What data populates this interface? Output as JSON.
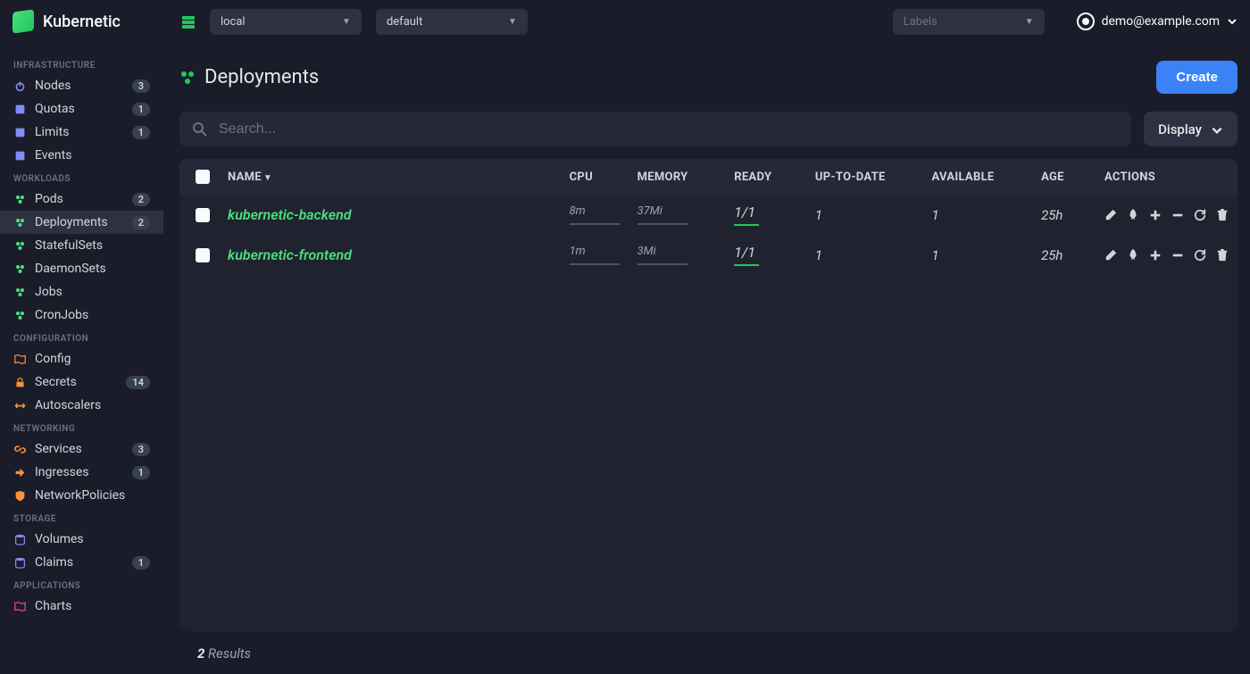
{
  "header": {
    "brand": "Kubernetic",
    "context_dropdown": "local",
    "namespace_dropdown": "default",
    "labels_placeholder": "Labels",
    "user_email": "demo@example.com"
  },
  "sidebar": {
    "sections": [
      {
        "header": "INFRASTRUCTURE",
        "items": [
          {
            "icon": "power",
            "color": "#818cf8",
            "label": "Nodes",
            "badge": "3"
          },
          {
            "icon": "square",
            "color": "#818cf8",
            "label": "Quotas",
            "badge": "1"
          },
          {
            "icon": "square",
            "color": "#818cf8",
            "label": "Limits",
            "badge": "1"
          },
          {
            "icon": "square",
            "color": "#818cf8",
            "label": "Events",
            "badge": ""
          }
        ]
      },
      {
        "header": "WORKLOADS",
        "items": [
          {
            "icon": "cubes",
            "color": "#4ade80",
            "label": "Pods",
            "badge": "2"
          },
          {
            "icon": "cubes",
            "color": "#4ade80",
            "label": "Deployments",
            "badge": "2",
            "active": true
          },
          {
            "icon": "cubes",
            "color": "#4ade80",
            "label": "StatefulSets",
            "badge": ""
          },
          {
            "icon": "cubes",
            "color": "#4ade80",
            "label": "DaemonSets",
            "badge": ""
          },
          {
            "icon": "cubes",
            "color": "#4ade80",
            "label": "Jobs",
            "badge": ""
          },
          {
            "icon": "cubes",
            "color": "#4ade80",
            "label": "CronJobs",
            "badge": ""
          }
        ]
      },
      {
        "header": "CONFIGURATION",
        "items": [
          {
            "icon": "map",
            "color": "#fb923c",
            "label": "Config",
            "badge": ""
          },
          {
            "icon": "lock",
            "color": "#fb923c",
            "label": "Secrets",
            "badge": "14"
          },
          {
            "icon": "arrows",
            "color": "#fb923c",
            "label": "Autoscalers",
            "badge": ""
          }
        ]
      },
      {
        "header": "NETWORKING",
        "items": [
          {
            "icon": "link",
            "color": "#fb923c",
            "label": "Services",
            "badge": "3"
          },
          {
            "icon": "signin",
            "color": "#fb923c",
            "label": "Ingresses",
            "badge": "1"
          },
          {
            "icon": "shield",
            "color": "#fb923c",
            "label": "NetworkPolicies",
            "badge": ""
          }
        ]
      },
      {
        "header": "STORAGE",
        "items": [
          {
            "icon": "database",
            "color": "#818cf8",
            "label": "Volumes",
            "badge": ""
          },
          {
            "icon": "database",
            "color": "#818cf8",
            "label": "Claims",
            "badge": "1"
          }
        ]
      },
      {
        "header": "APPLICATIONS",
        "items": [
          {
            "icon": "map",
            "color": "#ec4899",
            "label": "Charts",
            "badge": ""
          }
        ]
      }
    ]
  },
  "page": {
    "title": "Deployments",
    "create_label": "Create",
    "search_placeholder": "Search...",
    "display_label": "Display"
  },
  "table": {
    "columns": [
      "NAME",
      "CPU",
      "MEMORY",
      "READY",
      "UP-TO-DATE",
      "AVAILABLE",
      "AGE",
      "ACTIONS"
    ],
    "rows": [
      {
        "name": "kubernetic-backend",
        "cpu": "8m",
        "memory": "37Mi",
        "ready": "1/1",
        "uptodate": "1",
        "available": "1",
        "age": "25h"
      },
      {
        "name": "kubernetic-frontend",
        "cpu": "1m",
        "memory": "3Mi",
        "ready": "1/1",
        "uptodate": "1",
        "available": "1",
        "age": "25h"
      }
    ]
  },
  "footer": {
    "count": "2",
    "label": "Results"
  },
  "icons": {
    "power": "⏻",
    "square": "◧",
    "cubes": "⬢",
    "map": "🗺",
    "lock": "🔒",
    "arrows": "↔",
    "link": "🔗",
    "signin": "➜",
    "shield": "🛡",
    "database": "🗄"
  }
}
